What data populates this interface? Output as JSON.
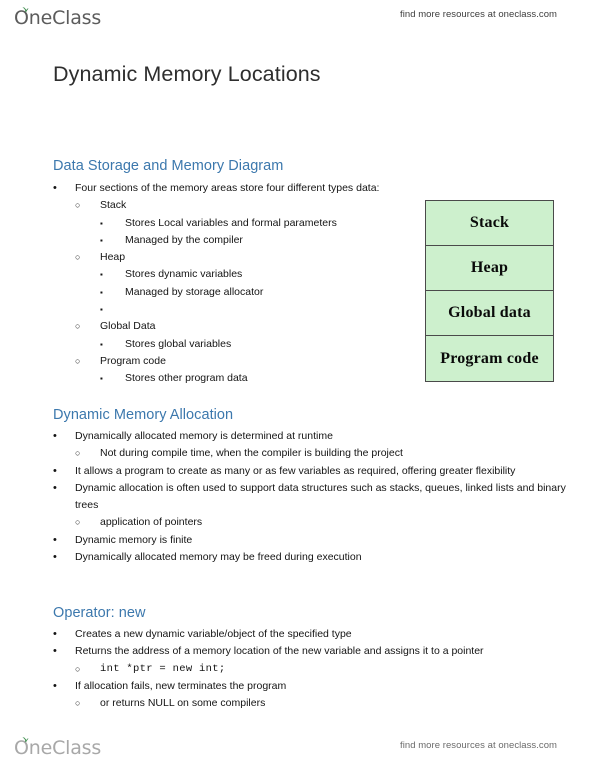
{
  "header": {
    "brand": "OneClass",
    "brand_icon": "leaf-sprout-icon",
    "tagline": "find more resources at oneclass.com"
  },
  "footer": {
    "brand": "OneClass",
    "brand_icon": "leaf-sprout-icon",
    "tagline": "find more resources at oneclass.com"
  },
  "document": {
    "title": "Dynamic Memory Locations",
    "accent_color": "#3c78ad",
    "sections": [
      {
        "heading": "Data Storage and Memory Diagram",
        "items": [
          {
            "text": "Four sections of the memory areas store four different types data:",
            "children": [
              {
                "text": "Stack",
                "children": [
                  {
                    "text": "Stores Local variables and formal parameters"
                  },
                  {
                    "text": "Managed by the compiler"
                  }
                ]
              },
              {
                "text": "Heap",
                "children": [
                  {
                    "text": "Stores dynamic variables"
                  },
                  {
                    "text": "Managed by storage allocator"
                  },
                  {
                    "text": ""
                  }
                ]
              },
              {
                "text": "Global Data",
                "children": [
                  {
                    "text": "Stores global variables"
                  }
                ]
              },
              {
                "text": "Program code",
                "children": [
                  {
                    "text": "Stores other program data"
                  }
                ]
              }
            ]
          }
        ]
      },
      {
        "heading": "Dynamic Memory Allocation",
        "items": [
          {
            "text": "Dynamically allocated memory is determined at runtime",
            "children": [
              {
                "text": "Not during compile time, when the compiler is building the project"
              }
            ]
          },
          {
            "text": "It allows a program to create as many or as few variables as required, offering greater flexibility"
          },
          {
            "text": "Dynamic allocation is often used to support data structures such as stacks, queues, linked lists and binary trees",
            "children": [
              {
                "text": "application of pointers"
              }
            ]
          },
          {
            "text": "Dynamic memory is finite"
          },
          {
            "text": "Dynamically allocated memory may be freed during execution"
          }
        ]
      },
      {
        "heading": "Operator: new",
        "items": [
          {
            "text": "Creates a new dynamic variable/object of the specified type"
          },
          {
            "text": "Returns the address of a memory location of the new variable and assigns it to a pointer",
            "children": [
              {
                "text": "int *ptr = new int;",
                "code": true
              }
            ]
          },
          {
            "text": "If allocation fails, new terminates the program",
            "children": [
              {
                "text": "or returns NULL on some compilers"
              }
            ]
          }
        ]
      }
    ]
  },
  "memory_diagram": {
    "fill_color": "#cdf0cd",
    "border_color": "#4a4a4a",
    "cells": [
      {
        "label": "Stack"
      },
      {
        "label": "Heap"
      },
      {
        "label": "Global data"
      },
      {
        "label": "Program code"
      }
    ]
  },
  "markers": {
    "level1": "•",
    "level2": "○",
    "level3": "▪"
  }
}
